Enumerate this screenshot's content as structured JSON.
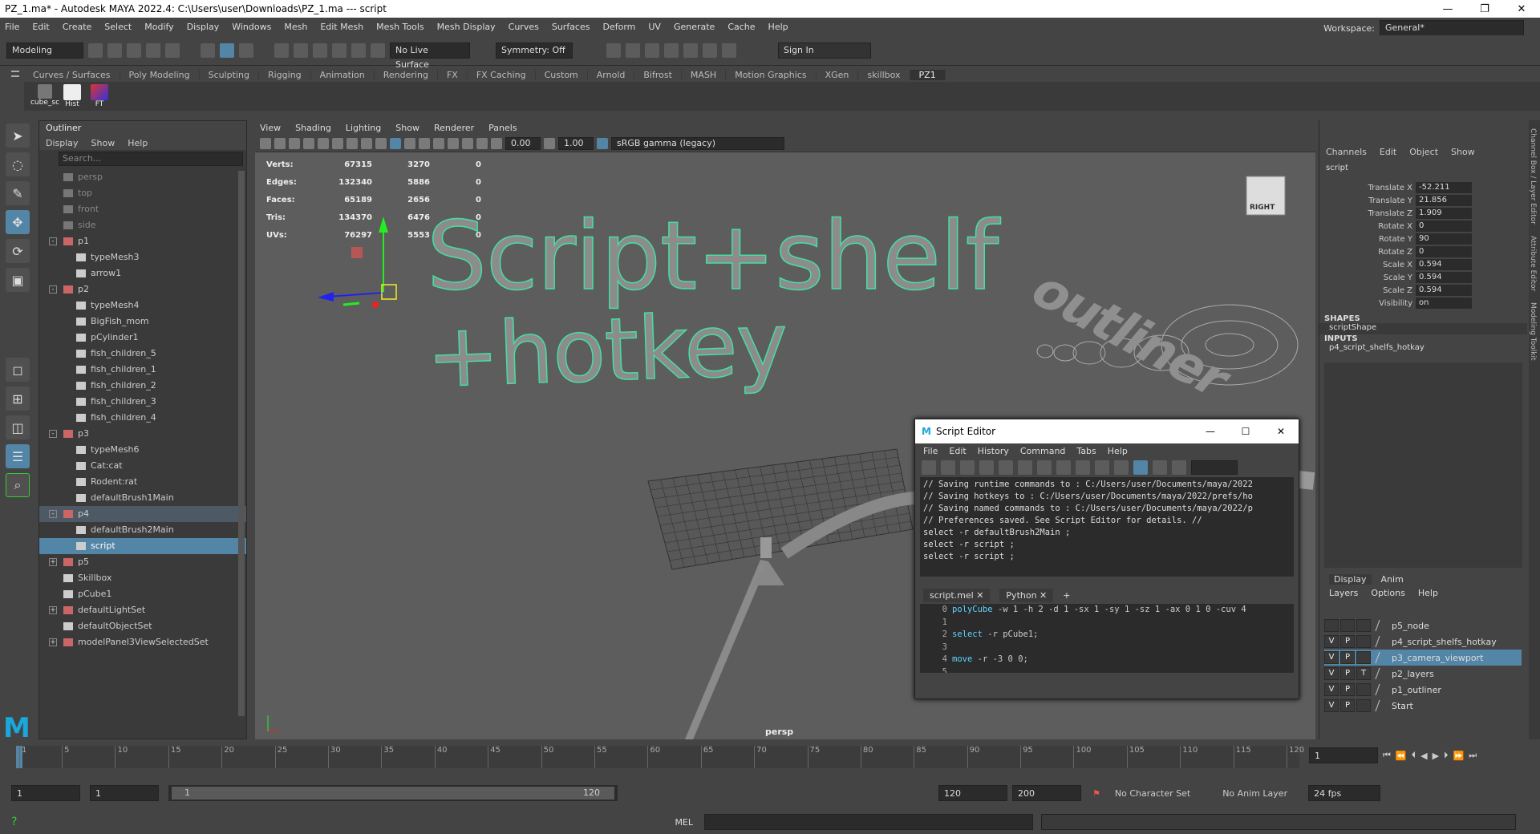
{
  "titlebar": {
    "title": "PZ_1.ma* - Autodesk MAYA 2022.4: C:\\Users\\user\\Downloads\\PZ_1.ma  ---  script"
  },
  "menubar": {
    "items": [
      "File",
      "Edit",
      "Create",
      "Select",
      "Modify",
      "Display",
      "Windows",
      "Mesh",
      "Edit Mesh",
      "Mesh Tools",
      "Mesh Display",
      "Curves",
      "Surfaces",
      "Deform",
      "UV",
      "Generate",
      "Cache",
      "Help"
    ],
    "workspace_label": "Workspace:",
    "workspace_value": "General*"
  },
  "statusline": {
    "mode": "Modeling",
    "live_surface": "No Live Surface",
    "symmetry": "Symmetry: Off",
    "sign_in": "Sign In"
  },
  "shelf": {
    "tabs": [
      "Curves / Surfaces",
      "Poly Modeling",
      "Sculpting",
      "Rigging",
      "Animation",
      "Rendering",
      "FX",
      "FX Caching",
      "Custom",
      "Arnold",
      "Bifrost",
      "MASH",
      "Motion Graphics",
      "XGen",
      "skillbox",
      "PZ1"
    ],
    "active_tab": "PZ1",
    "buttons": [
      {
        "label": "cube_sc"
      },
      {
        "label": "Hist"
      },
      {
        "label": "FT"
      }
    ]
  },
  "outliner": {
    "title": "Outliner",
    "menu": [
      "Display",
      "Show",
      "Help"
    ],
    "search_placeholder": "Search...",
    "rows": [
      {
        "label": "persp",
        "indent": 0,
        "dim": true
      },
      {
        "label": "top",
        "indent": 0,
        "dim": true
      },
      {
        "label": "front",
        "indent": 0,
        "dim": true
      },
      {
        "label": "side",
        "indent": 0,
        "dim": true
      },
      {
        "label": "p1",
        "indent": 0,
        "exp": "-"
      },
      {
        "label": "typeMesh3",
        "indent": 1
      },
      {
        "label": "arrow1",
        "indent": 1
      },
      {
        "label": "p2",
        "indent": 0,
        "exp": "-"
      },
      {
        "label": "typeMesh4",
        "indent": 1
      },
      {
        "label": "BigFish_mom",
        "indent": 1
      },
      {
        "label": "pCylinder1",
        "indent": 1
      },
      {
        "label": "fish_children_5",
        "indent": 1
      },
      {
        "label": "fish_children_1",
        "indent": 1
      },
      {
        "label": "fish_children_2",
        "indent": 1
      },
      {
        "label": "fish_children_3",
        "indent": 1
      },
      {
        "label": "fish_children_4",
        "indent": 1
      },
      {
        "label": "p3",
        "indent": 0,
        "exp": "-"
      },
      {
        "label": "typeMesh6",
        "indent": 1
      },
      {
        "label": "Cat:cat",
        "indent": 1
      },
      {
        "label": "Rodent:rat",
        "indent": 1
      },
      {
        "label": "defaultBrush1Main",
        "indent": 1
      },
      {
        "label": "p4",
        "indent": 0,
        "exp": "-",
        "hl": true
      },
      {
        "label": "defaultBrush2Main",
        "indent": 1
      },
      {
        "label": "script",
        "indent": 1,
        "sel": true
      },
      {
        "label": "p5",
        "indent": 0,
        "exp": "+"
      },
      {
        "label": "Skillbox",
        "indent": 0
      },
      {
        "label": "pCube1",
        "indent": 0
      },
      {
        "label": "defaultLightSet",
        "indent": 0,
        "exp": "+"
      },
      {
        "label": "defaultObjectSet",
        "indent": 0
      },
      {
        "label": "modelPanel3ViewSelectedSet",
        "indent": 0,
        "exp": "+"
      }
    ]
  },
  "viewport": {
    "menu": [
      "View",
      "Shading",
      "Lighting",
      "Show",
      "Renderer",
      "Panels"
    ],
    "field_a": "0.00",
    "field_b": "1.00",
    "color_space": "sRGB gamma (legacy)",
    "hud": [
      {
        "label": "Verts:",
        "a": "67315",
        "b": "3270",
        "c": "0"
      },
      {
        "label": "Edges:",
        "a": "132340",
        "b": "5886",
        "c": "0"
      },
      {
        "label": "Faces:",
        "a": "65189",
        "b": "2656",
        "c": "0"
      },
      {
        "label": "Tris:",
        "a": "134370",
        "b": "6476",
        "c": "0"
      },
      {
        "label": "UVs:",
        "a": "76297",
        "b": "5553",
        "c": "0"
      }
    ],
    "text_line1": "Script+shelf",
    "text_line2": "+hotkey",
    "side_text": "outliner",
    "viewcube_label": "RIGHT",
    "camera": "persp"
  },
  "channelbox": {
    "menu": [
      "Channels",
      "Edit",
      "Object",
      "Show"
    ],
    "object": "script",
    "channels": [
      {
        "label": "Translate X",
        "value": "-52.211"
      },
      {
        "label": "Translate Y",
        "value": "21.856"
      },
      {
        "label": "Translate Z",
        "value": "1.909"
      },
      {
        "label": "Rotate X",
        "value": "0"
      },
      {
        "label": "Rotate Y",
        "value": "90"
      },
      {
        "label": "Rotate Z",
        "value": "0"
      },
      {
        "label": "Scale X",
        "value": "0.594"
      },
      {
        "label": "Scale Y",
        "value": "0.594"
      },
      {
        "label": "Scale Z",
        "value": "0.594"
      },
      {
        "label": "Visibility",
        "value": "on"
      }
    ],
    "shapes_title": "SHAPES",
    "shape": "scriptShape",
    "inputs_title": "INPUTS",
    "input": "p4_script_shelfs_hotkay",
    "side_tabs": [
      "Channel Box / Layer Editor",
      "Attribute Editor",
      "Modeling Toolkit"
    ]
  },
  "layers": {
    "tabs": [
      "Display",
      "Anim"
    ],
    "menu": [
      "Layers",
      "Options",
      "Help"
    ],
    "rows": [
      {
        "v": "",
        "p": "",
        "t": "",
        "name": "p5_node"
      },
      {
        "v": "V",
        "p": "P",
        "t": "",
        "name": "p4_script_shelfs_hotkay"
      },
      {
        "v": "V",
        "p": "P",
        "t": "",
        "name": "p3_camera_viewport",
        "sel": true
      },
      {
        "v": "V",
        "p": "P",
        "t": "T",
        "name": "p2_layers"
      },
      {
        "v": "V",
        "p": "P",
        "t": "",
        "name": "p1_outliner"
      },
      {
        "v": "V",
        "p": "P",
        "t": "",
        "name": "Start"
      }
    ]
  },
  "script_editor": {
    "title": "Script Editor",
    "menu": [
      "File",
      "Edit",
      "History",
      "Command",
      "Tabs",
      "Help"
    ],
    "output": [
      "// Saving runtime commands to : C:/Users/user/Documents/maya/2022",
      "// Saving hotkeys to : C:/Users/user/Documents/maya/2022/prefs/ho",
      "// Saving named commands to : C:/Users/user/Documents/maya/2022/p",
      "// Preferences saved. See Script Editor for details. //",
      "select -r defaultBrush2Main ;",
      "select -r script ;",
      "select -r script ;"
    ],
    "tabs": [
      "script.mel",
      "Python",
      "+"
    ],
    "lines": [
      {
        "n": "0",
        "kw": "polyCube",
        "rest": " -w 1 -h 2 -d 1 -sx 1 -sy 1 -sz 1 -ax 0 1 0 -cuv 4"
      },
      {
        "n": "1",
        "kw": "",
        "rest": ""
      },
      {
        "n": "2",
        "kw": "select",
        "rest": " -r pCube1;"
      },
      {
        "n": "3",
        "kw": "",
        "rest": ""
      },
      {
        "n": "4",
        "kw": "move",
        "rest": " -r -3 0 0;"
      },
      {
        "n": "5",
        "kw": "",
        "rest": ""
      }
    ]
  },
  "timeline": {
    "ticks": [
      "1",
      "5",
      "10",
      "15",
      "20",
      "25",
      "30",
      "35",
      "40",
      "45",
      "50",
      "55",
      "60",
      "65",
      "70",
      "75",
      "80",
      "85",
      "90",
      "95",
      "100",
      "105",
      "110",
      "115",
      "120"
    ],
    "current_frame": "1"
  },
  "range": {
    "start": "1",
    "anim_start": "1",
    "slider_start": "1",
    "slider_end": "120",
    "end": "120",
    "anim_end": "200",
    "character_set": "No Character Set",
    "anim_layer": "No Anim Layer",
    "fps": "24 fps"
  },
  "cmdline": {
    "lang": "MEL"
  }
}
